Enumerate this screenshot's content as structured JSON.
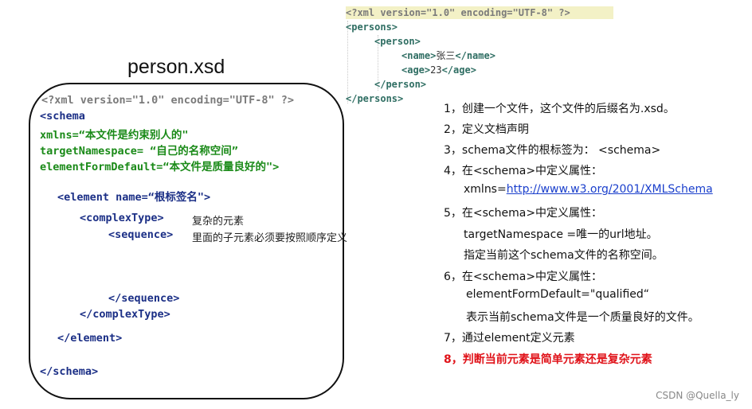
{
  "xml_sample": {
    "declaration": "<?xml version=\"1.0\" encoding=\"UTF-8\" ?>",
    "persons_open": "<persons>",
    "person_open": "<person>",
    "name_open": "<name>",
    "name_value": "张三",
    "name_close": "</name>",
    "age_open": "<age>",
    "age_value": "23",
    "age_close": "</age>",
    "person_close": "</person>",
    "persons_close": "</persons>"
  },
  "schema_title": "person.xsd",
  "schema_code": {
    "declaration": "<?xml version=\"1.0\" encoding=\"UTF-8\" ?>",
    "schema_open": "<schema",
    "xmlns": "xmlns=“本文件是约束别人的\"",
    "target_namespace": "targetNamespace= “自己的名称空间”",
    "element_form_default": "elementFormDefault=“本文件是质量良好的\">",
    "element_open": "<element name=“根标签名\">",
    "complex_type_open": "<complexType>",
    "complex_type_note": "复杂的元素",
    "sequence_open": "<sequence>",
    "sequence_note": "里面的子元素必须要按照顺序定义",
    "sequence_close": "</sequence>",
    "complex_type_close": "</complexType>",
    "element_close": "</element>",
    "schema_close": "</schema>"
  },
  "steps": {
    "s1": "1，创建一个文件，这个文件的后缀名为.xsd。",
    "s2": "2，定义文档声明",
    "s3": "3，schema文件的根标签为： <schema>",
    "s4": "4，在<schema>中定义属性：",
    "s4_prefix": "xmlns=",
    "s4_link": "http://www.w3.org/2001/XMLSchema",
    "s5": "5，在<schema>中定义属性：",
    "s5_a": "targetNamespace =唯一的url地址。",
    "s5_b": "指定当前这个schema文件的名称空间。",
    "s6": "6，在<schema>中定义属性：",
    "s6_a": "elementFormDefault=\"qualified“",
    "s6_b": "表示当前schema文件是一个质量良好的文件。",
    "s7": "7，通过element定义元素",
    "s8": "8，判断当前元素是简单元素还是复杂元素"
  },
  "watermark": "CSDN @Quella_ly",
  "colors": {
    "tag": "#1f3fa8",
    "string": "#1a8a18",
    "highlight_text": "#e0131a",
    "link": "#1a3fcc"
  }
}
